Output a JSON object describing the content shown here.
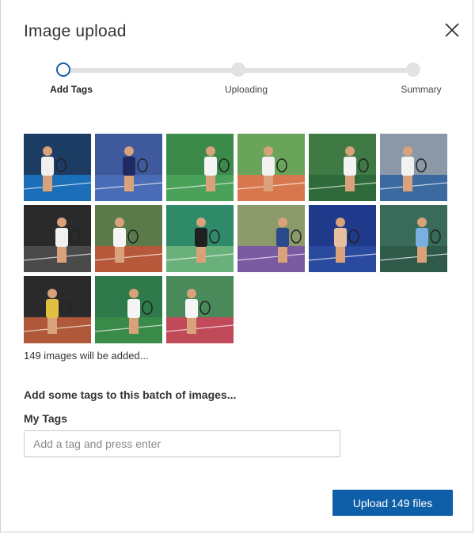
{
  "dialog": {
    "title": "Image upload",
    "close_icon": "close-icon"
  },
  "stepper": {
    "steps": [
      {
        "label": "Add Tags",
        "state": "active"
      },
      {
        "label": "Uploading",
        "state": "pending"
      },
      {
        "label": "Summary",
        "state": "pending"
      }
    ]
  },
  "thumbnails": [
    {
      "subject": "tennis-player-1",
      "bg": "#1d3c63",
      "court": "#1a6fb8",
      "player": "#f0f0f0"
    },
    {
      "subject": "tennis-player-2",
      "bg": "#3f5a9c",
      "court": "#4a6cb6",
      "player": "#1f2a62"
    },
    {
      "subject": "tennis-player-3",
      "bg": "#3c8a4a",
      "court": "#4aa25a",
      "player": "#f5f5f5"
    },
    {
      "subject": "tennis-player-4",
      "bg": "#6aa45a",
      "court": "#d8774e",
      "player": "#f2f2f2"
    },
    {
      "subject": "tennis-player-5",
      "bg": "#3f7a45",
      "court": "#2f6a3a",
      "player": "#f3f3f3"
    },
    {
      "subject": "tennis-player-6",
      "bg": "#8a98a8",
      "court": "#3a6aa0",
      "player": "#f2f2f2"
    },
    {
      "subject": "tennis-player-7",
      "bg": "#2a2a2a",
      "court": "#4a4a4a",
      "player": "#f0f0f0"
    },
    {
      "subject": "tennis-player-8",
      "bg": "#5a7a4a",
      "court": "#b8583a",
      "player": "#f5f5f5"
    },
    {
      "subject": "tennis-player-9",
      "bg": "#2f8a6a",
      "court": "#6ab07a",
      "player": "#202020"
    },
    {
      "subject": "tennis-player-10",
      "bg": "#8a9a6a",
      "court": "#7a5aa0",
      "player": "#2a4a8a"
    },
    {
      "subject": "tennis-player-11",
      "bg": "#1f3a8a",
      "court": "#2a4aa0",
      "player": "#e8c0a0"
    },
    {
      "subject": "tennis-player-12",
      "bg": "#3a6a5a",
      "court": "#2f5a4a",
      "player": "#7ab0e0"
    },
    {
      "subject": "tennis-player-13",
      "bg": "#2a2a2a",
      "court": "#b0583a",
      "player": "#e0c040"
    },
    {
      "subject": "tennis-player-14",
      "bg": "#2f7a4a",
      "court": "#3a8a4a",
      "player": "#f5f5f5"
    },
    {
      "subject": "tennis-player-15",
      "bg": "#4a8a5a",
      "court": "#c04a5a",
      "player": "#f5f5f5"
    }
  ],
  "count_text": "149 images will be added...",
  "tags": {
    "heading": "Add some tags to this batch of images...",
    "label": "My Tags",
    "input_value": "",
    "input_placeholder": "Add a tag and press enter"
  },
  "actions": {
    "upload_label": "Upload 149 files"
  },
  "colors": {
    "accent": "#0f5ea8",
    "step_active_ring": "#1a5fa8",
    "track": "#e2e2e2"
  }
}
